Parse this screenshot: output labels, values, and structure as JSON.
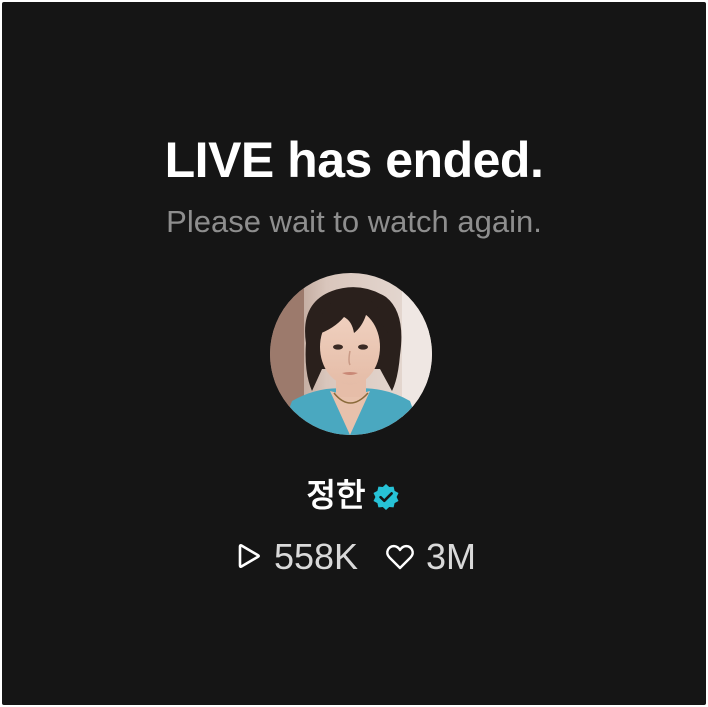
{
  "screen": {
    "title": "LIVE has ended.",
    "subtitle": "Please wait to watch again."
  },
  "profile": {
    "name": "정한",
    "avatar_icon": "avatar-photo",
    "verified_icon": "verified-badge-icon",
    "verified_color": "#27c2d6"
  },
  "stats": {
    "plays_icon": "play-icon",
    "plays": "558K",
    "likes_icon": "heart-icon",
    "likes": "3M"
  },
  "colors": {
    "background": "#151515",
    "title": "#ffffff",
    "subtitle": "#8e8e8e",
    "stats": "#d9d9d9"
  }
}
